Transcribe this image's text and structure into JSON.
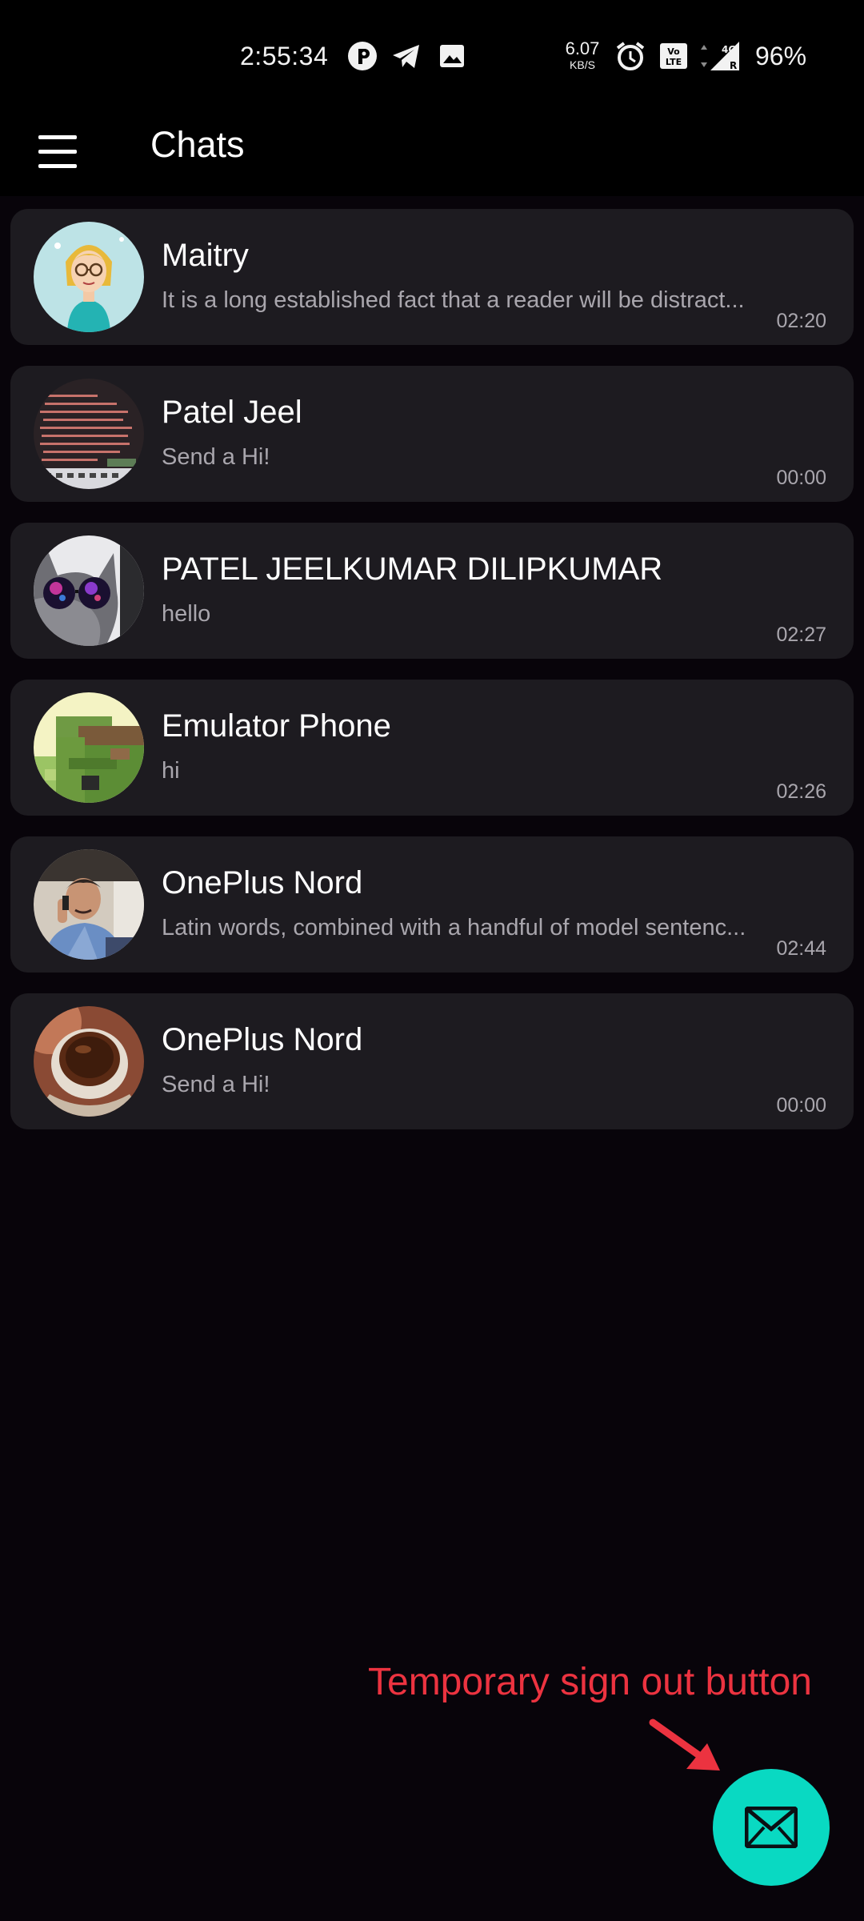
{
  "status_bar": {
    "time": "2:55:34",
    "net_speed_value": "6.07",
    "net_speed_unit": "KB/S",
    "battery": "96%",
    "icons": [
      "app-notification-icon",
      "telegram-icon",
      "gallery-icon",
      "alarm-icon",
      "volte-icon",
      "signal-4g-icon"
    ]
  },
  "header": {
    "title": "Chats",
    "menu_icon": "hamburger-menu-icon"
  },
  "chats": [
    {
      "name": "Maitry",
      "preview": "It is a long established fact that a reader will be distract...",
      "time": "02:20",
      "avatar": "cartoon-girl-avatar"
    },
    {
      "name": "Patel Jeel",
      "preview": "Send a Hi!",
      "time": "00:00",
      "avatar": "code-screen-avatar"
    },
    {
      "name": "PATEL JEELKUMAR DILIPKUMAR",
      "preview": "hello",
      "time": "02:27",
      "avatar": "cat-sunglasses-avatar"
    },
    {
      "name": "Emulator Phone",
      "preview": "hi",
      "time": "02:26",
      "avatar": "pixel-art-avatar"
    },
    {
      "name": "OnePlus Nord",
      "preview": "Latin words, combined with a handful of model sentenc...",
      "time": "02:44",
      "avatar": "man-phone-avatar"
    },
    {
      "name": "OnePlus Nord",
      "preview": "Send a Hi!",
      "time": "00:00",
      "avatar": "coffee-cup-avatar"
    }
  ],
  "annotation": {
    "text": "Temporary sign out button",
    "color": "#ec3340"
  },
  "fab": {
    "icon": "mail-icon",
    "color": "#09d9c2"
  }
}
